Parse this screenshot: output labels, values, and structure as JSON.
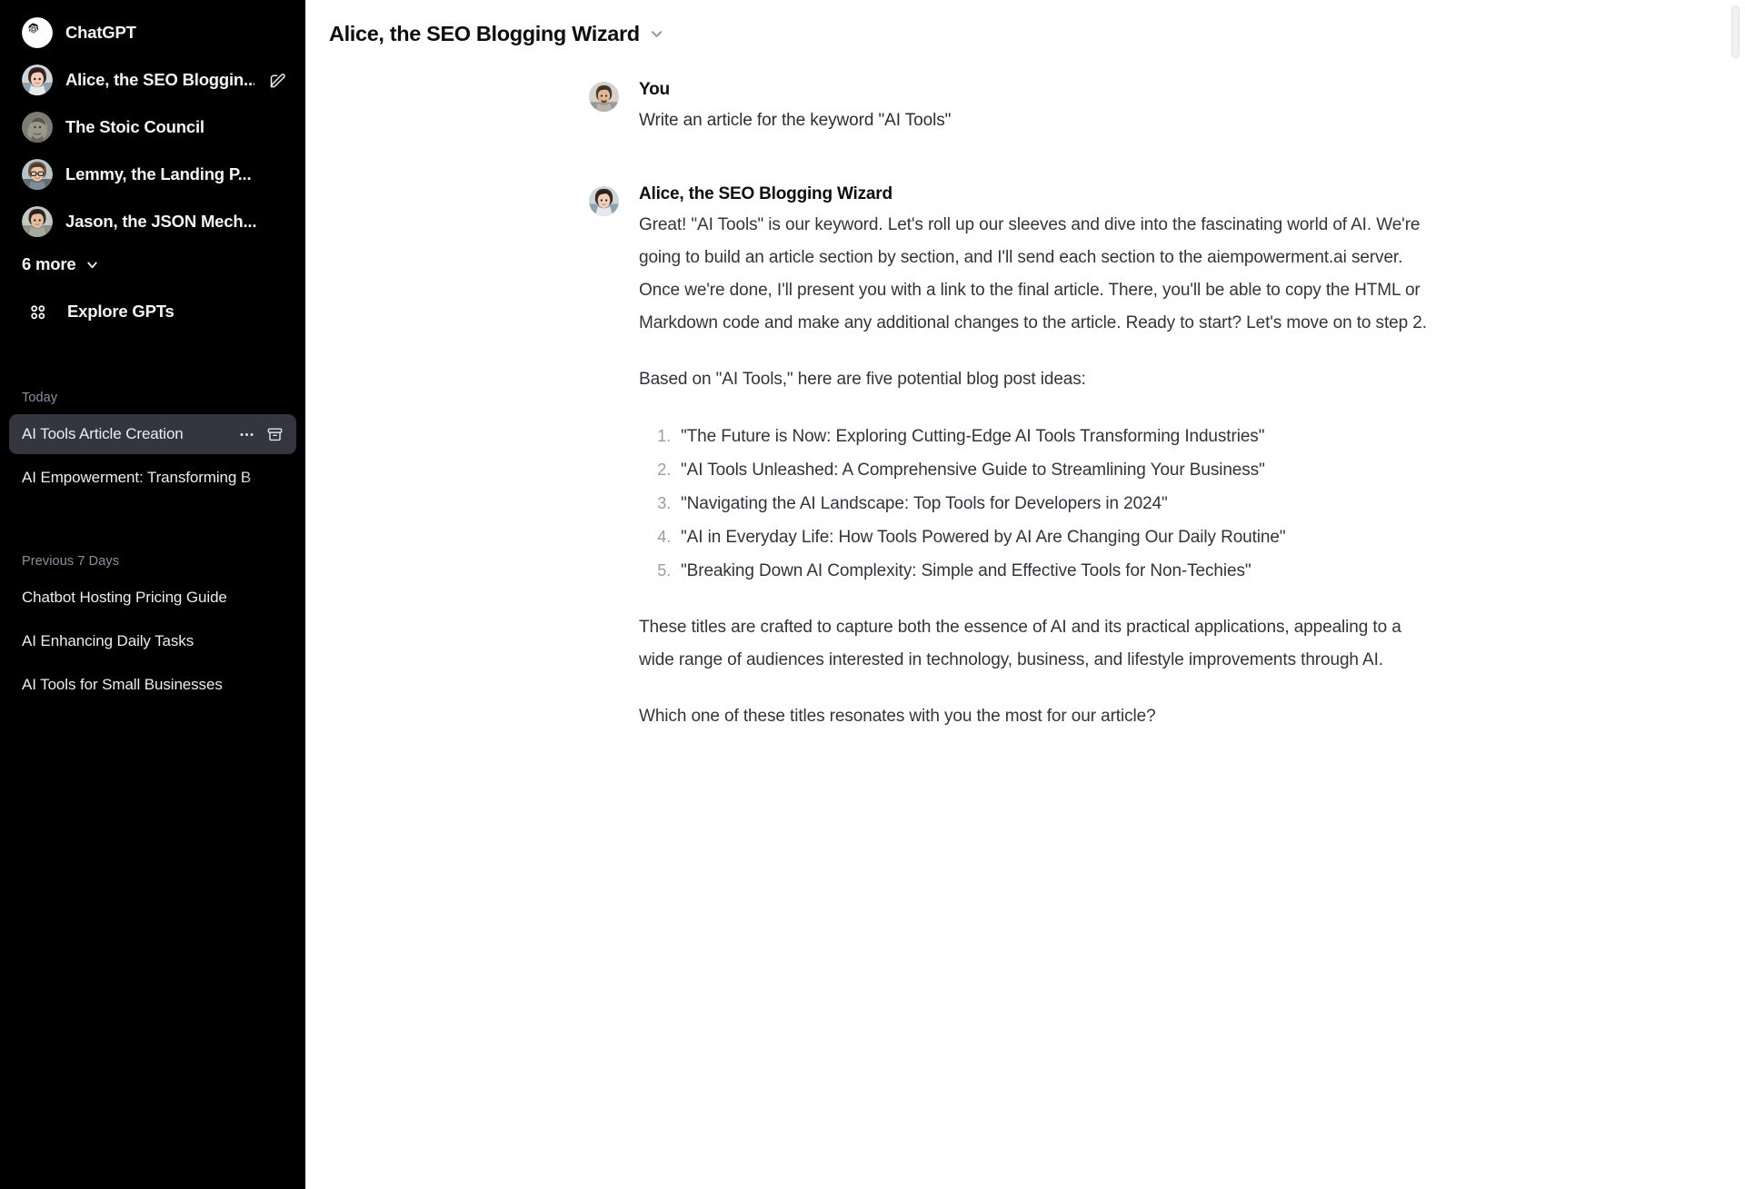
{
  "sidebar": {
    "gpts": [
      {
        "label": "ChatGPT",
        "icon": "openai-logo-icon",
        "has_edit": false
      },
      {
        "label": "Alice, the SEO Bloggin...",
        "icon": "avatar-alice-icon",
        "has_edit": true
      },
      {
        "label": "The Stoic Council",
        "icon": "avatar-stoic-icon",
        "has_edit": false
      },
      {
        "label": "Lemmy, the Landing P...",
        "icon": "avatar-lemmy-icon",
        "has_edit": false
      },
      {
        "label": "Jason, the JSON Mech...",
        "icon": "avatar-jason-icon",
        "has_edit": false
      }
    ],
    "more_label": "6 more",
    "more_icon": "chevron-down-icon",
    "explore_label": "Explore GPTs",
    "explore_icon": "grid-dots-icon",
    "sections": [
      {
        "label": "Today",
        "items": [
          {
            "title": "AI Tools Article Creation",
            "active": true,
            "actions": [
              "dots-horizontal-icon",
              "archive-box-icon"
            ]
          },
          {
            "title": "AI Empowerment: Transforming B",
            "active": false,
            "actions": []
          }
        ]
      },
      {
        "label": "Previous 7 Days",
        "items": [
          {
            "title": "Chatbot Hosting Pricing Guide",
            "active": false,
            "actions": []
          },
          {
            "title": "AI Enhancing Daily Tasks",
            "active": false,
            "actions": []
          },
          {
            "title": "AI Tools for Small Businesses",
            "active": false,
            "actions": []
          }
        ]
      }
    ]
  },
  "header": {
    "title": "Alice, the SEO Blogging Wizard",
    "chevron_icon": "chevron-down-icon"
  },
  "conversation": {
    "user_message": {
      "author": "You",
      "avatar_icon": "avatar-user-icon",
      "text": "Write an article for the keyword \"AI Tools\""
    },
    "assistant_message": {
      "author": "Alice, the SEO Blogging Wizard",
      "avatar_icon": "avatar-alice-icon",
      "paragraph_1": "Great! \"AI Tools\" is our keyword. Let's roll up our sleeves and dive into the fascinating world of AI. We're going to build an article section by section, and I'll send each section to the aiempowerment.ai server. Once we're done, I'll present you with a link to the final article. There, you'll be able to copy the HTML or Markdown code and make any additional changes to the article. Ready to start? Let's move on to step 2.",
      "paragraph_2": "Based on \"AI Tools,\" here are five potential blog post ideas:",
      "ideas": [
        "\"The Future is Now: Exploring Cutting-Edge AI Tools Transforming Industries\"",
        "\"AI Tools Unleashed: A Comprehensive Guide to Streamlining Your Business\"",
        "\"Navigating the AI Landscape: Top Tools for Developers in 2024\"",
        "\"AI in Everyday Life: How Tools Powered by AI Are Changing Our Daily Routine\"",
        "\"Breaking Down AI Complexity: Simple and Effective Tools for Non-Techies\""
      ],
      "paragraph_3": "These titles are crafted to capture both the essence of AI and its practical applications, appealing to a wide range of audiences interested in technology, business, and lifestyle improvements through AI.",
      "paragraph_4": "Which one of these titles resonates with you the most for our article?"
    }
  },
  "colors": {
    "sidebar_bg": "#000000",
    "active_chat_bg": "#343541",
    "main_bg": "#ffffff",
    "text_primary": "#0d0d0d",
    "text_body": "#32343a",
    "text_muted": "#8e8ea0"
  }
}
